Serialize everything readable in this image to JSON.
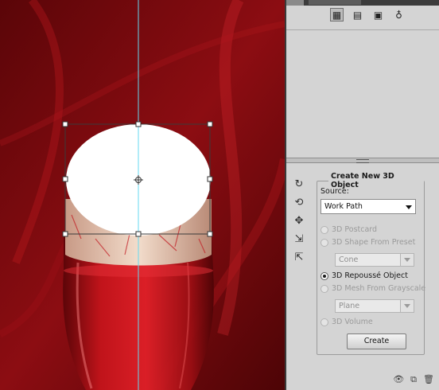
{
  "canvas": {
    "background_color": "#7a0b0f",
    "glass_color": "#c4141b",
    "froth_color": "#e7c9b4",
    "guide_color": "#64d8f0"
  },
  "panel_icons": [
    "scene-icon",
    "grid-icon",
    "mesh-icon",
    "light-icon"
  ],
  "create_3d": {
    "title": "Create New 3D Object",
    "source_label": "Source:",
    "source_value": "Work Path",
    "options": {
      "postcard": "3D Postcard",
      "shape_from_preset": "3D Shape From Preset",
      "preset_value": "Cone",
      "repousse": "3D Repoussé Object",
      "mesh_from_grayscale": "3D Mesh From Grayscale",
      "mesh_value": "Plane",
      "volume": "3D Volume"
    },
    "selected_option": "3D Repoussé Object",
    "create_button": "Create"
  }
}
